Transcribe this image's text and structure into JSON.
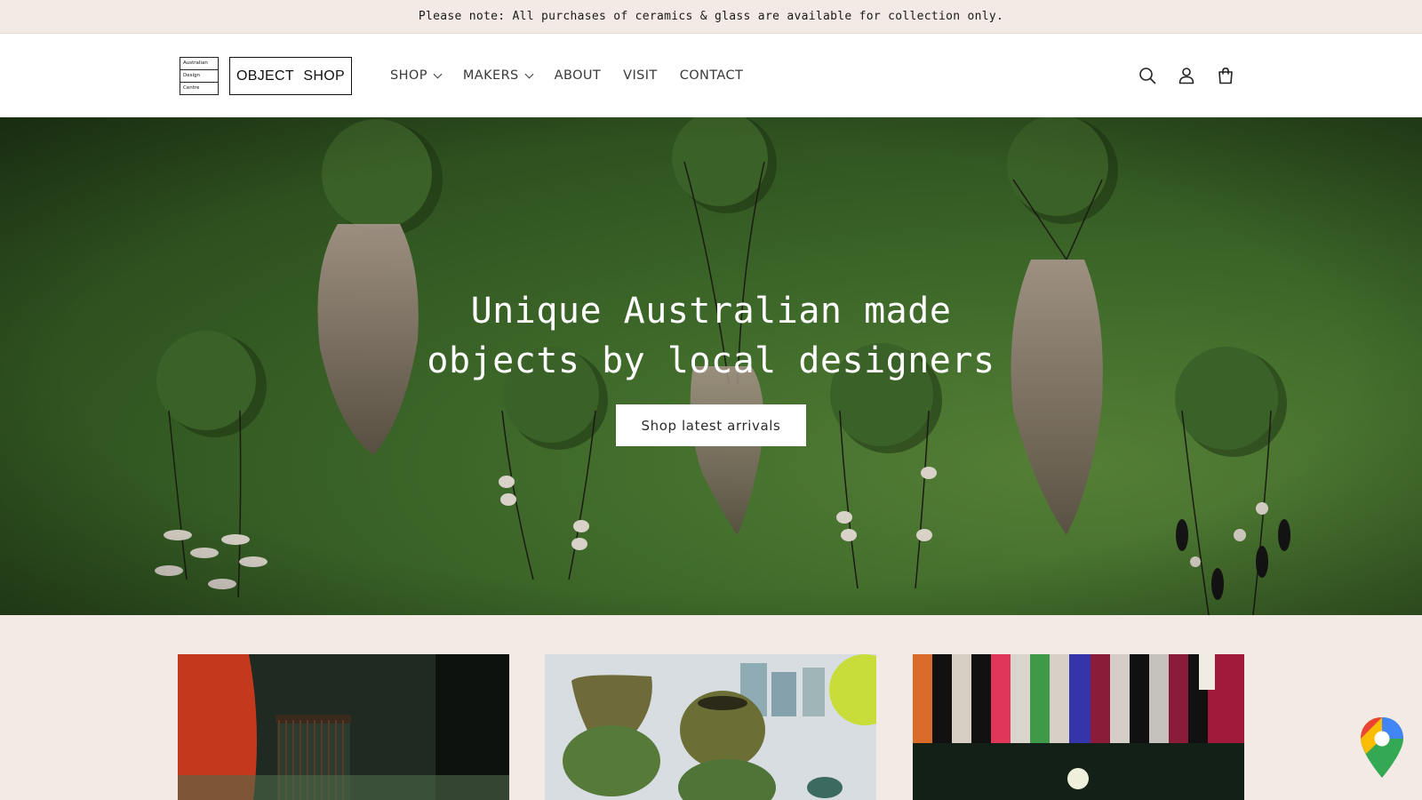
{
  "announcement": {
    "text": "Please note: All purchases of ceramics & glass are available for collection only."
  },
  "logo": {
    "lines": [
      "Australian",
      "Design",
      "Centre"
    ],
    "shop_name": "OBJECT  SHOP"
  },
  "nav": {
    "items": [
      {
        "label": "SHOP",
        "has_dropdown": true
      },
      {
        "label": "MAKERS",
        "has_dropdown": true
      },
      {
        "label": "ABOUT",
        "has_dropdown": false
      },
      {
        "label": "VISIT",
        "has_dropdown": false
      },
      {
        "label": "CONTACT",
        "has_dropdown": false
      }
    ]
  },
  "header_icons": [
    "search-icon",
    "account-icon",
    "cart-icon"
  ],
  "hero": {
    "heading": "Unique Australian made\nobjects by local designers",
    "button_label": "Shop latest arrivals",
    "background_color": "#3f6a2a"
  },
  "cards": [
    {
      "name": "vessels-card"
    },
    {
      "name": "ceramics-card"
    },
    {
      "name": "textiles-card"
    }
  ],
  "floating_icon": "google-maps-icon"
}
